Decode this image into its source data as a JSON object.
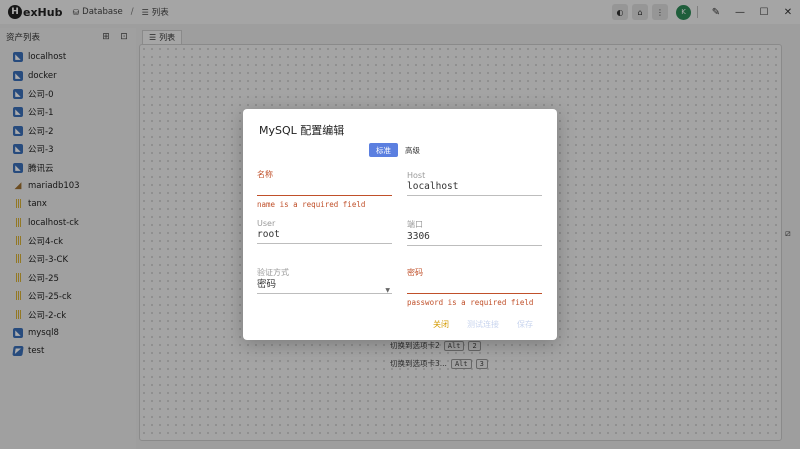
{
  "app": {
    "logo_letter": "H",
    "logo_text": "exHub",
    "breadcrumb": {
      "db_label": "Database",
      "separator": "/",
      "list_label": "列表"
    },
    "avatar_letter": "K"
  },
  "sidebar": {
    "title": "资产列表",
    "items": [
      {
        "label": "localhost",
        "icon": "mysql-icon"
      },
      {
        "label": "docker",
        "icon": "mysql-icon"
      },
      {
        "label": "公司-0",
        "icon": "mysql-icon"
      },
      {
        "label": "公司-1",
        "icon": "mysql-icon"
      },
      {
        "label": "公司-2",
        "icon": "mysql-icon"
      },
      {
        "label": "公司-3",
        "icon": "mysql-icon"
      },
      {
        "label": "腾讯云",
        "icon": "mysql-icon"
      },
      {
        "label": "mariadb103",
        "icon": "mariadb-icon"
      },
      {
        "label": "tanx",
        "icon": "clickhouse-icon"
      },
      {
        "label": "localhost-ck",
        "icon": "clickhouse-icon"
      },
      {
        "label": "公司4-ck",
        "icon": "clickhouse-icon"
      },
      {
        "label": "公司-3-CK",
        "icon": "clickhouse-icon"
      },
      {
        "label": "公司-25",
        "icon": "clickhouse-icon"
      },
      {
        "label": "公司-25-ck",
        "icon": "clickhouse-icon"
      },
      {
        "label": "公司-2-ck",
        "icon": "clickhouse-icon"
      },
      {
        "label": "mysql8",
        "icon": "mysql-icon"
      },
      {
        "label": "test",
        "icon": "test-icon"
      }
    ]
  },
  "main": {
    "tab_label": "列表",
    "shortcuts": [
      {
        "label": "切换到选项卡2",
        "key1": "Alt",
        "key2": "2"
      },
      {
        "label": "切换到选项卡3...",
        "key1": "Alt",
        "key2": "3"
      }
    ]
  },
  "dialog": {
    "title": "MySQL 配置编辑",
    "tab_standard": "标准",
    "tab_advanced": "高级",
    "name_label": "名称",
    "name_value": "",
    "name_error": "name is a required field",
    "host_label": "Host",
    "host_value": "localhost",
    "user_label": "User",
    "user_value": "root",
    "port_label": "端口",
    "port_value": "3306",
    "auth_label": "验证方式",
    "auth_value": "密码",
    "password_label": "密码",
    "password_value": "",
    "password_error": "password is a required field",
    "btn_close": "关闭",
    "btn_test": "测试连接",
    "btn_save": "保存"
  },
  "colors": {
    "accent": "#5b7fe0",
    "error": "#c0502a",
    "close_button": "#d49a00"
  }
}
